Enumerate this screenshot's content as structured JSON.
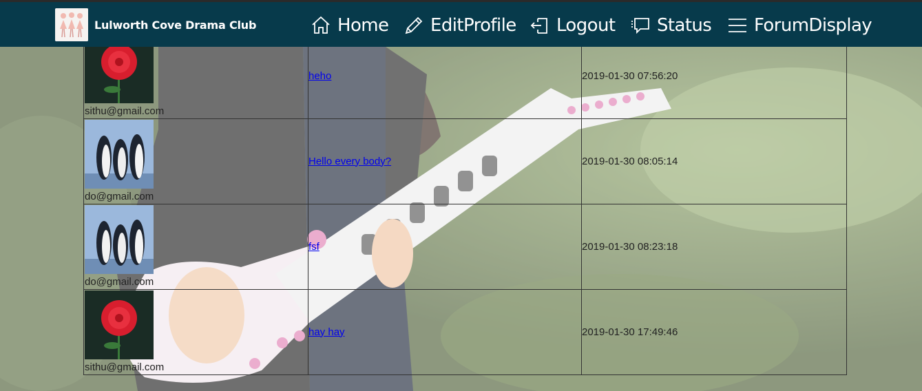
{
  "navbar": {
    "brand": "Lulworth Cove Drama Club",
    "items": [
      {
        "label": "Home",
        "icon": "home-icon"
      },
      {
        "label": "EditProfile",
        "icon": "pencil-icon"
      },
      {
        "label": "Logout",
        "icon": "logout-icon"
      },
      {
        "label": "Status",
        "icon": "chat-icon"
      },
      {
        "label": "ForumDisplay",
        "icon": "menu-icon"
      }
    ]
  },
  "posts": [
    {
      "email": "sithu@gmail.com",
      "avatar": "flower-avatar",
      "message": "heho",
      "time": "2019-01-30 07:56:20"
    },
    {
      "email": "do@gmail.com",
      "avatar": "penguin-avatar",
      "message": "Hello every body?",
      "time": "2019-01-30 08:05:14"
    },
    {
      "email": "do@gmail.com",
      "avatar": "penguin-avatar",
      "message": "fsf",
      "time": "2019-01-30 08:23:18"
    },
    {
      "email": "sithu@gmail.com",
      "avatar": "flower-avatar",
      "message": "hay hay",
      "time": "2019-01-30 17:49:46"
    }
  ],
  "colors": {
    "navbar": "#073a4b",
    "link": "#0000ee"
  }
}
